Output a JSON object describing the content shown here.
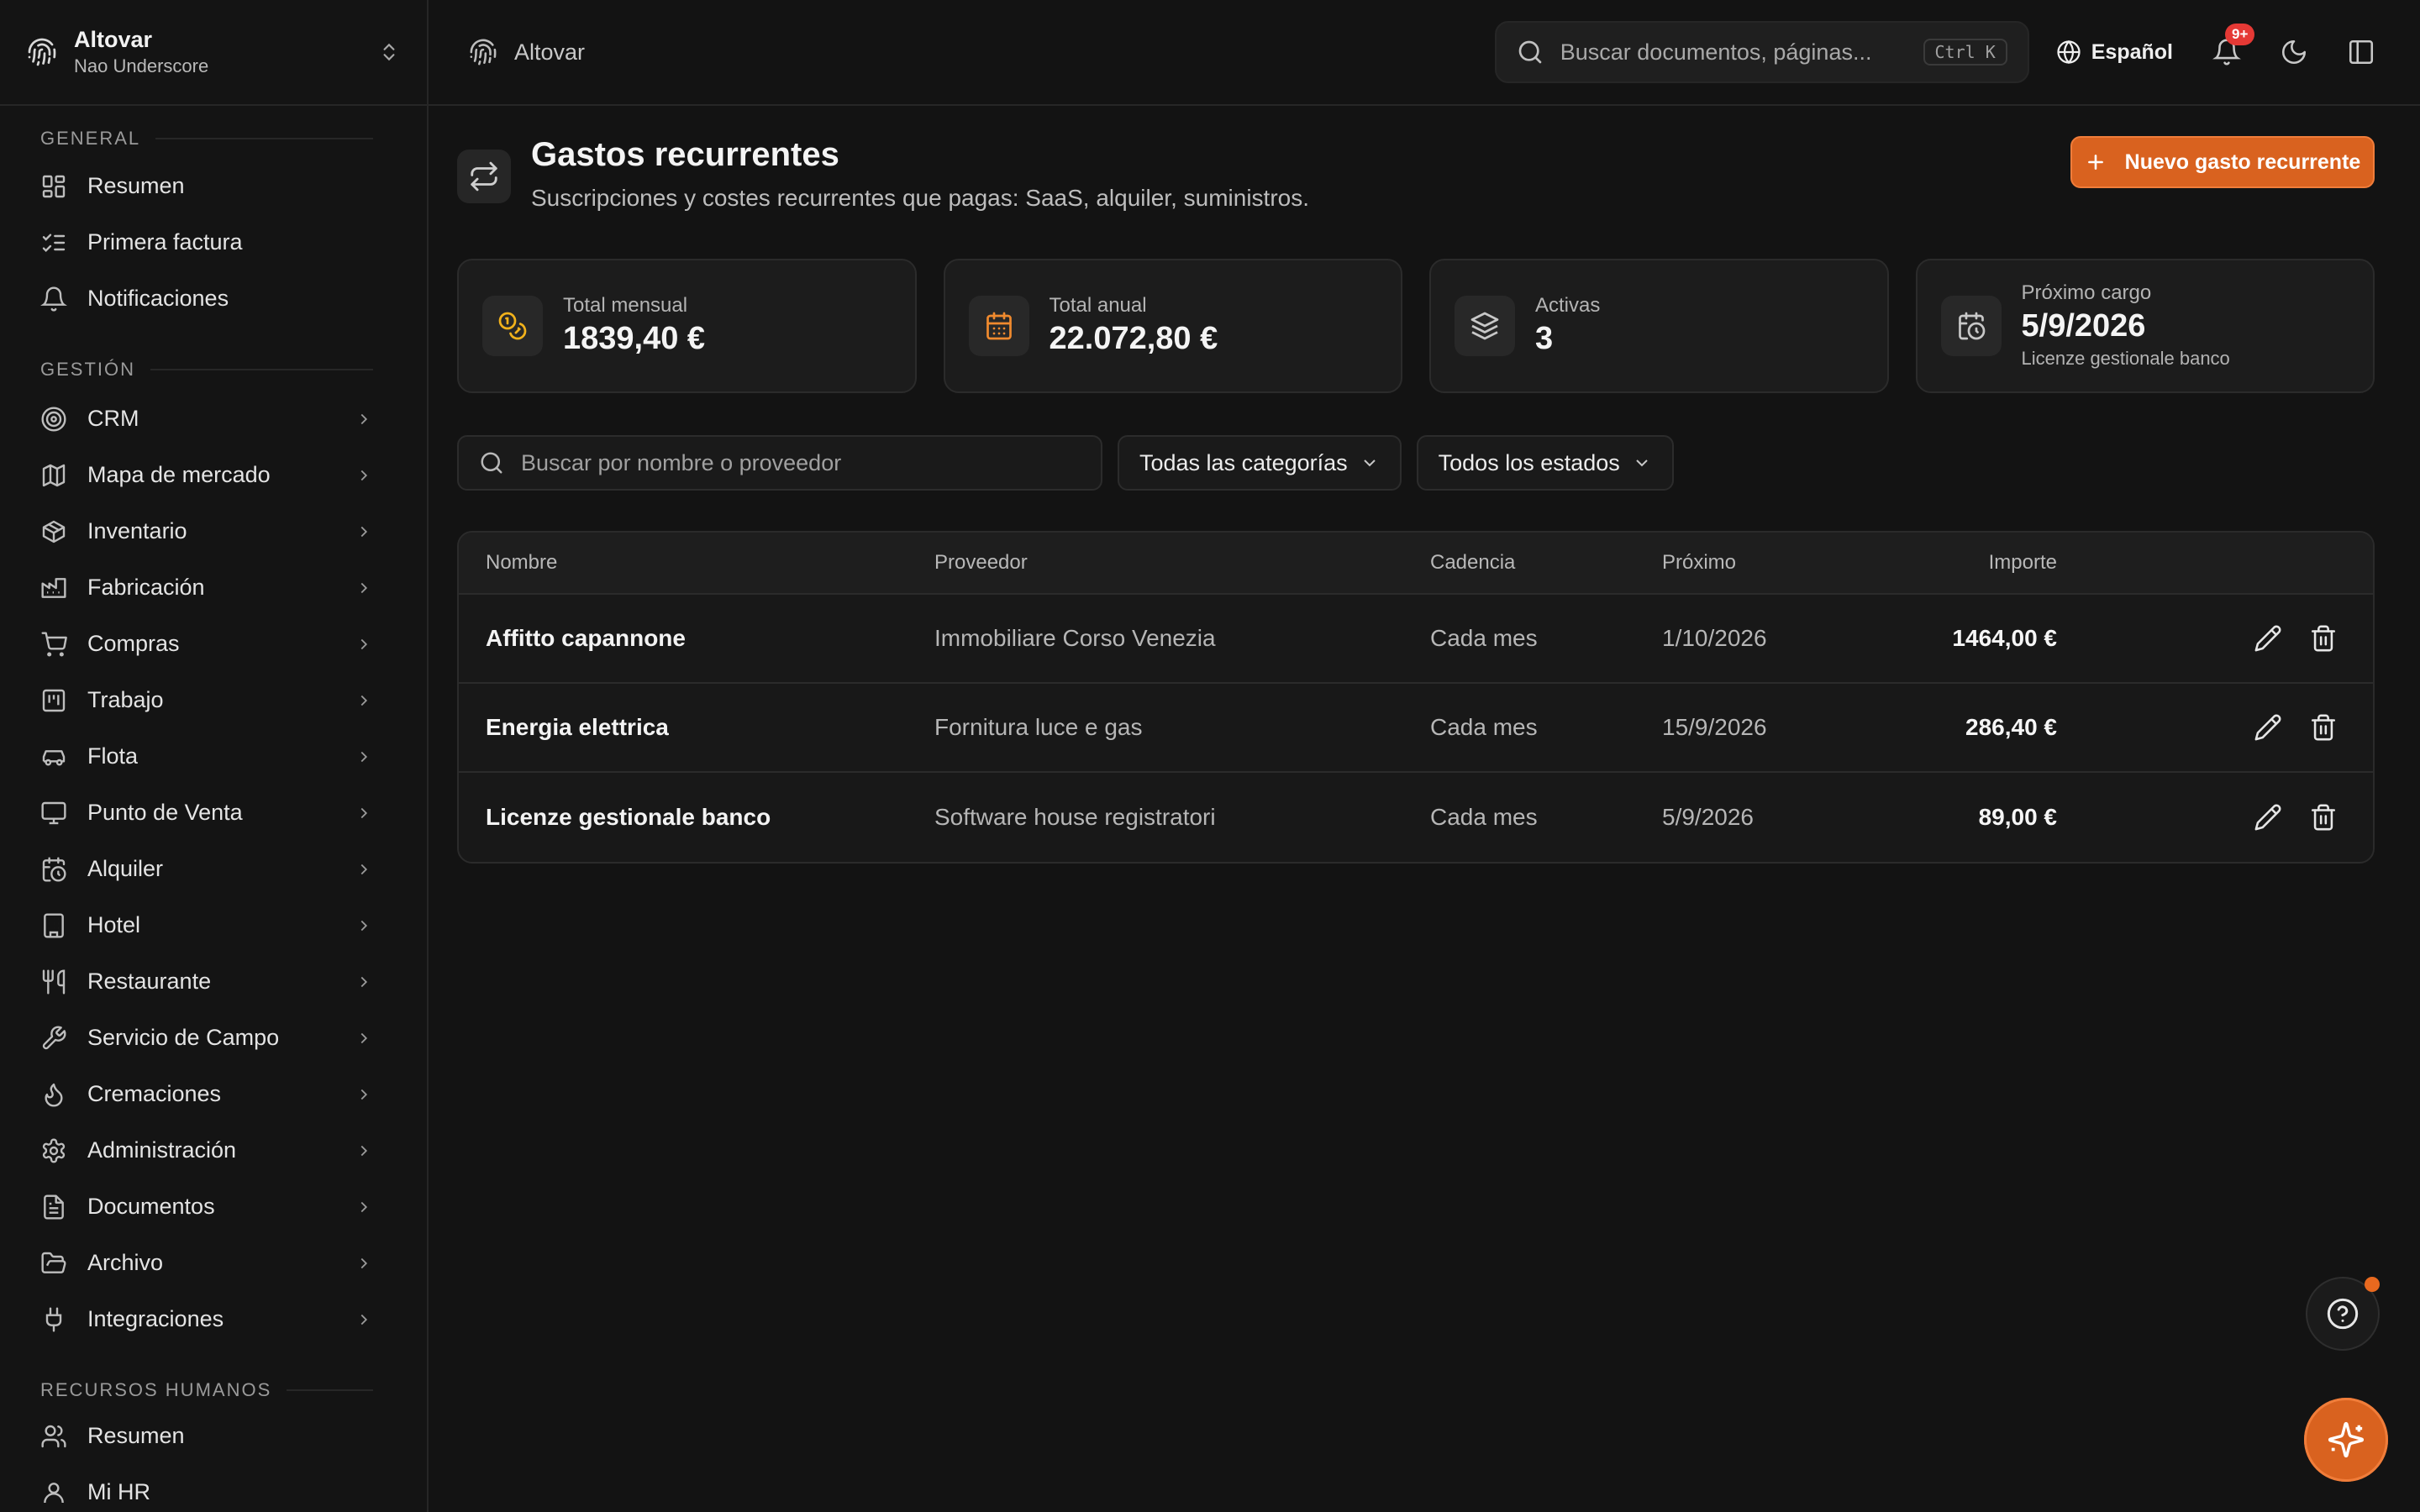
{
  "workspace": {
    "name": "Altovar",
    "user": "Nao Underscore"
  },
  "sidebar": {
    "general_title": "GENERAL",
    "general_items": [
      {
        "label": "Resumen"
      },
      {
        "label": "Primera factura"
      },
      {
        "label": "Notificaciones"
      }
    ],
    "gestion_title": "GESTIÓN",
    "gestion_items": [
      {
        "label": "CRM"
      },
      {
        "label": "Mapa de mercado"
      },
      {
        "label": "Inventario"
      },
      {
        "label": "Fabricación"
      },
      {
        "label": "Compras"
      },
      {
        "label": "Trabajo"
      },
      {
        "label": "Flota"
      },
      {
        "label": "Punto de Venta"
      },
      {
        "label": "Alquiler"
      },
      {
        "label": "Hotel"
      },
      {
        "label": "Restaurante"
      },
      {
        "label": "Servicio de Campo"
      },
      {
        "label": "Cremaciones"
      },
      {
        "label": "Administración"
      },
      {
        "label": "Documentos"
      },
      {
        "label": "Archivo"
      },
      {
        "label": "Integraciones"
      }
    ],
    "rrhh_title": "RECURSOS HUMANOS",
    "rrhh_items": [
      {
        "label": "Resumen"
      },
      {
        "label": "Mi HR"
      }
    ]
  },
  "topbar": {
    "breadcrumb": "Altovar",
    "search_placeholder": "Buscar documentos, páginas...",
    "shortcut": "Ctrl K",
    "language": "Español",
    "notif_badge": "9+"
  },
  "page": {
    "title": "Gastos recurrentes",
    "subtitle": "Suscripciones y costes recurrentes que pagas: SaaS, alquiler, suministros.",
    "new_button": "Nuevo gasto recurrente"
  },
  "stats": [
    {
      "label": "Total mensual",
      "value": "1839,40 €",
      "icon": "coins-icon",
      "color": "#f2b21b"
    },
    {
      "label": "Total anual",
      "value": "22.072,80 €",
      "icon": "calendar-icon",
      "color": "#f08a2e"
    },
    {
      "label": "Activas",
      "value": "3",
      "icon": "layers-icon",
      "color": "#c8c8c8"
    },
    {
      "label": "Próximo cargo",
      "value": "5/9/2026",
      "note": "Licenze gestionale banco",
      "icon": "calendar-clock-icon",
      "color": "#c8c8c8"
    }
  ],
  "filters": {
    "search_placeholder": "Buscar por nombre o proveedor",
    "category": "Todas las categorías",
    "status": "Todos los estados"
  },
  "table": {
    "headers": {
      "name": "Nombre",
      "provider": "Proveedor",
      "cadence": "Cadencia",
      "next": "Próximo",
      "amount": "Importe"
    },
    "rows": [
      {
        "name": "Affitto capannone",
        "provider": "Immobiliare Corso Venezia",
        "cadence": "Cada mes",
        "next": "1/10/2026",
        "amount": "1464,00 €"
      },
      {
        "name": "Energia elettrica",
        "provider": "Fornitura luce e gas",
        "cadence": "Cada mes",
        "next": "15/9/2026",
        "amount": "286,40 €"
      },
      {
        "name": "Licenze gestionale banco",
        "provider": "Software house registratori",
        "cadence": "Cada mes",
        "next": "5/9/2026",
        "amount": "89,00 €"
      }
    ]
  },
  "colors": {
    "accent": "#d9621f",
    "badge": "#e53935"
  }
}
